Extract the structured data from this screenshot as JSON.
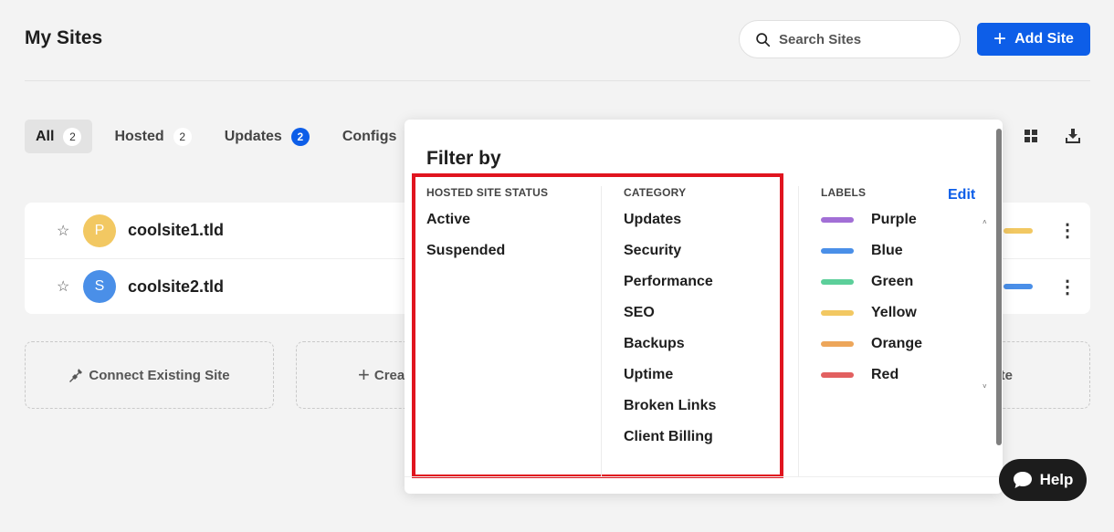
{
  "header": {
    "title": "My Sites",
    "search_placeholder": "Search Sites",
    "add_site_label": "Add Site",
    "add_site_icon": "plus-icon"
  },
  "tabs": [
    {
      "label": "All",
      "count": "2",
      "active": true
    },
    {
      "label": "Hosted",
      "count": "2"
    },
    {
      "label": "Updates",
      "count": "2",
      "highlight_count": true
    },
    {
      "label": "Configs"
    }
  ],
  "sites": [
    {
      "name": "coolsite1.tld",
      "initial": "P",
      "avatar_color": "#f2c862",
      "label_color": "#f2c862"
    },
    {
      "name": "coolsite2.tld",
      "initial": "S",
      "avatar_color": "#4a8fe8",
      "label_color": "#4a8fe8"
    }
  ],
  "actions": {
    "connect_label": "Connect Existing Site",
    "create_label": "Crea",
    "third_label": "te"
  },
  "filter": {
    "title": "Filter by",
    "status": {
      "heading": "HOSTED SITE STATUS",
      "items": [
        "Active",
        "Suspended"
      ]
    },
    "category": {
      "heading": "CATEGORY",
      "items": [
        "Updates",
        "Security",
        "Performance",
        "SEO",
        "Backups",
        "Uptime",
        "Broken Links",
        "Client Billing"
      ]
    },
    "labels": {
      "heading": "LABELS",
      "edit_label": "Edit",
      "items": [
        {
          "name": "Purple",
          "color": "#a26fd6"
        },
        {
          "name": "Blue",
          "color": "#4a8fe8"
        },
        {
          "name": "Green",
          "color": "#5ccf9a"
        },
        {
          "name": "Yellow",
          "color": "#f2c862"
        },
        {
          "name": "Orange",
          "color": "#eda65a"
        },
        {
          "name": "Red",
          "color": "#e26060"
        }
      ]
    }
  },
  "help": {
    "label": "Help"
  },
  "colors": {
    "accent": "#0d5ee8",
    "highlight_border": "#e0141f"
  }
}
